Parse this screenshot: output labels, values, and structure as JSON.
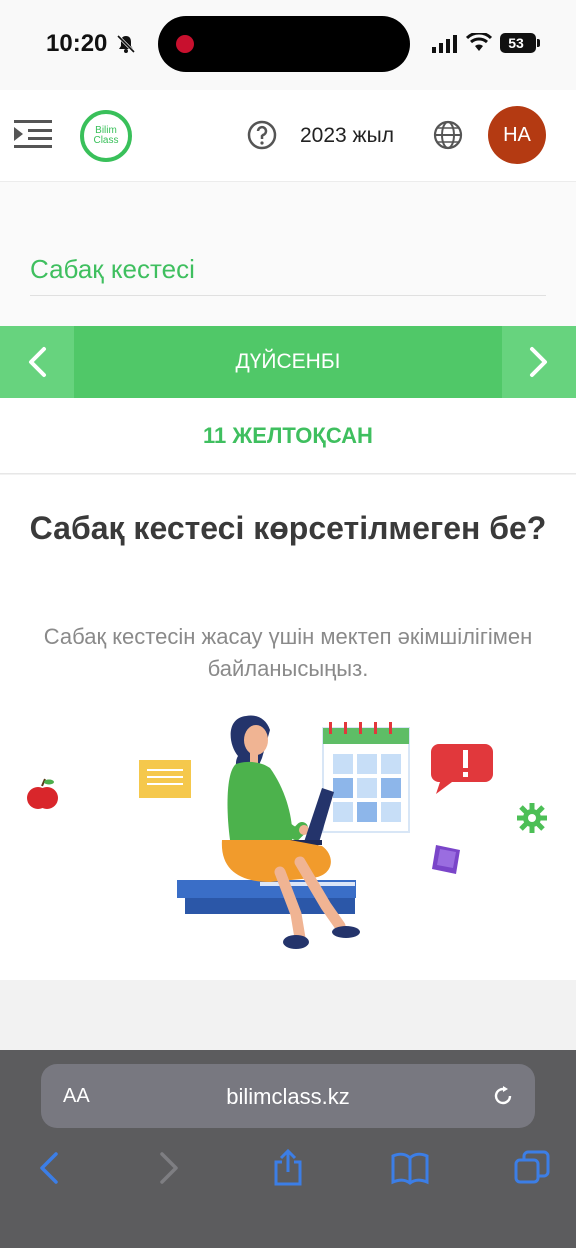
{
  "status_bar": {
    "time": "10:20",
    "battery": "53"
  },
  "header": {
    "logo_text_1": "Bilim",
    "logo_text_2": "Class",
    "year": "2023 жыл",
    "avatar_initials": "НА"
  },
  "page": {
    "title": "Сабақ кестесі"
  },
  "day_nav": {
    "day": "ДҮЙСЕНБІ",
    "date": "11 ЖЕЛТОҚСАН"
  },
  "empty_state": {
    "title": "Сабақ кестесі көрсетілмеген бе?",
    "text": "Сабақ кестесін жасау үшін мектеп әкімшілігімен байланысыңыз."
  },
  "browser": {
    "aa_label": "AA",
    "url": "bilimclass.kz"
  },
  "colors": {
    "accent": "#3fbf5f",
    "nav_green": "#50c868",
    "avatar": "#b43a12"
  }
}
